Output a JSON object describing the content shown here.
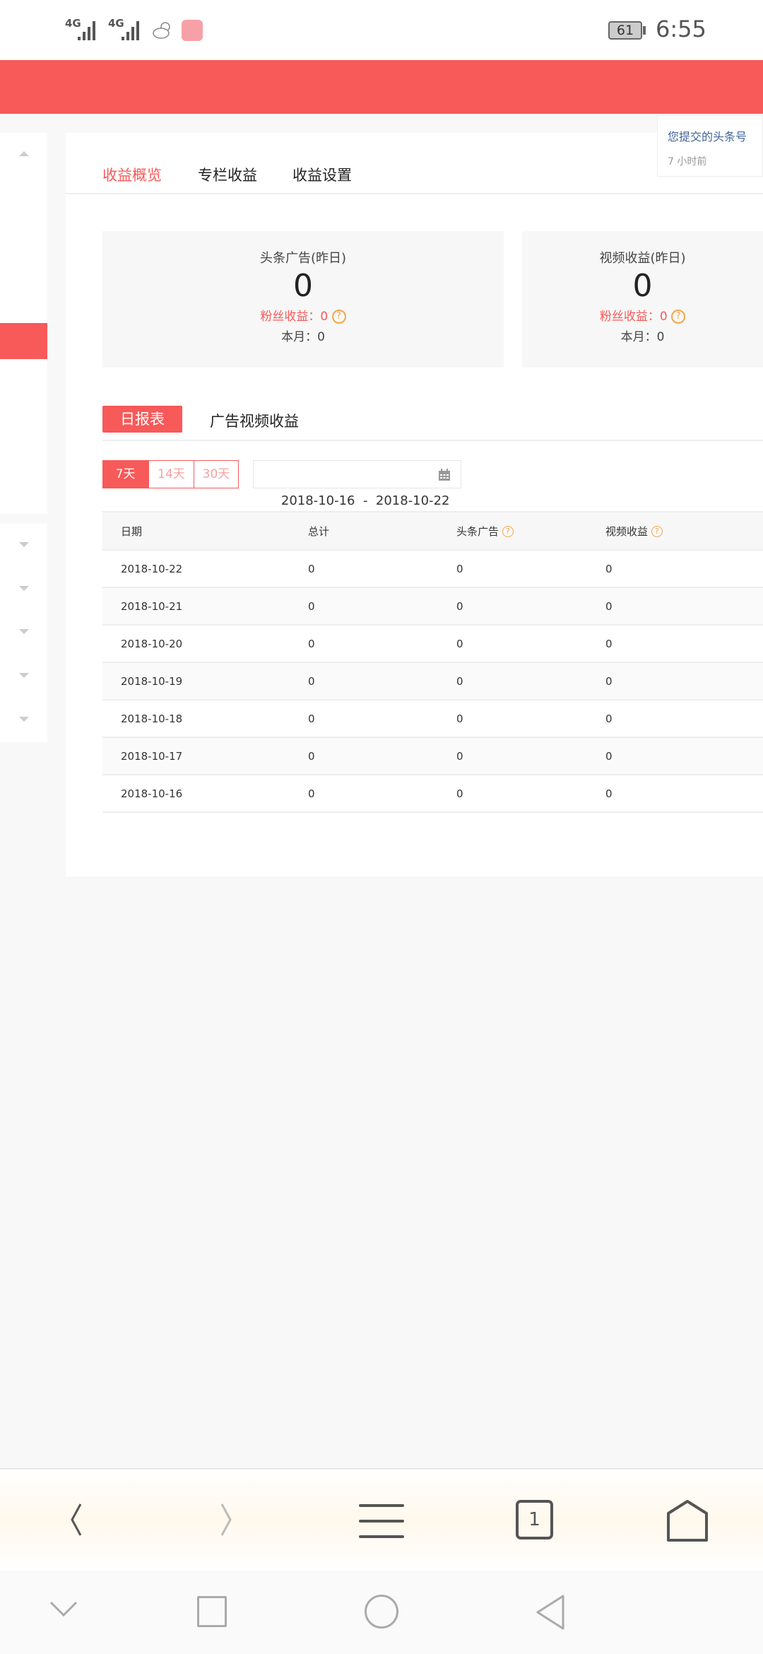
{
  "status_bar": {
    "network1": "4G",
    "network2": "4G",
    "battery": "61",
    "time": "6:55"
  },
  "notification": {
    "text": "您提交的头条号",
    "time": "7 小时前"
  },
  "tabs": [
    {
      "label": "收益概览",
      "active": true
    },
    {
      "label": "专栏收益",
      "active": false
    },
    {
      "label": "收益设置",
      "active": false
    }
  ],
  "stats": [
    {
      "title": "头条广告(昨日)",
      "value": "0",
      "fans": "粉丝收益：0",
      "month": "本月：0"
    },
    {
      "title": "视频收益(昨日)",
      "value": "0",
      "fans": "粉丝收益：0",
      "month": "本月：0"
    }
  ],
  "subtabs": [
    {
      "label": "日报表",
      "active": true
    },
    {
      "label": "广告视频收益",
      "active": false
    }
  ],
  "ranges": [
    {
      "label": "7天",
      "active": true
    },
    {
      "label": "14天",
      "active": false
    },
    {
      "label": "30天",
      "active": false
    }
  ],
  "date_range": "2018-10-16  -  2018-10-22",
  "table": {
    "headers": [
      "日期",
      "总计",
      "头条广告",
      "视频收益"
    ],
    "rows": [
      [
        "2018-10-22",
        "0",
        "0",
        "0"
      ],
      [
        "2018-10-21",
        "0",
        "0",
        "0"
      ],
      [
        "2018-10-20",
        "0",
        "0",
        "0"
      ],
      [
        "2018-10-19",
        "0",
        "0",
        "0"
      ],
      [
        "2018-10-18",
        "0",
        "0",
        "0"
      ],
      [
        "2018-10-17",
        "0",
        "0",
        "0"
      ],
      [
        "2018-10-16",
        "0",
        "0",
        "0"
      ]
    ]
  },
  "browser": {
    "tab_count": "1"
  },
  "colors": {
    "accent": "#f85959",
    "help": "#f5a54a",
    "link": "#406599"
  }
}
